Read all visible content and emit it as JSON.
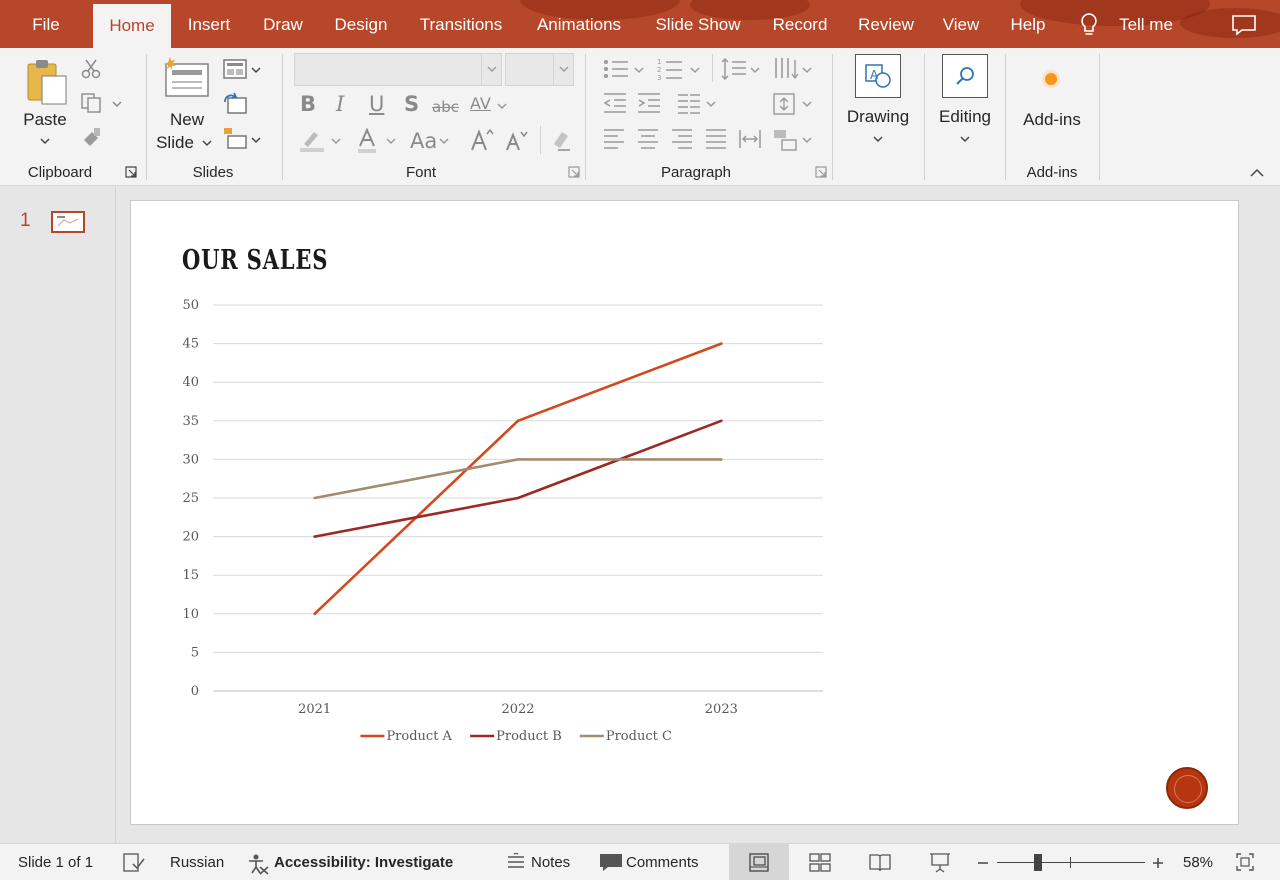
{
  "ribbon_tabs": [
    "File",
    "Home",
    "Insert",
    "Draw",
    "Design",
    "Transitions",
    "Animations",
    "Slide Show",
    "Record",
    "Review",
    "View",
    "Help"
  ],
  "tell_me": "Tell me",
  "active_tab": "Home",
  "clipboard": {
    "paste_label": "Paste",
    "group_label": "Clipboard"
  },
  "slides_group": {
    "new_label": "New",
    "slide_label": "Slide",
    "group_label": "Slides"
  },
  "font_group": {
    "font_name": "",
    "font_size": "",
    "bold": "B",
    "italic": "I",
    "underline": "U",
    "shadow": "S",
    "strike": "abc",
    "spacing": "AV",
    "case": "Aa",
    "group_label": "Font"
  },
  "paragraph_group": {
    "group_label": "Paragraph"
  },
  "drawing": {
    "label": "Drawing"
  },
  "editing": {
    "label": "Editing"
  },
  "addins": {
    "button_label": "Add-ins",
    "group_label": "Add-ins"
  },
  "thumbnail": {
    "number": "1"
  },
  "slide": {
    "title": "OUR SALES"
  },
  "chart_data": {
    "type": "line",
    "title": "",
    "xlabel": "",
    "ylabel": "",
    "categories": [
      "2021",
      "2022",
      "2023"
    ],
    "ylim": [
      0,
      50
    ],
    "yticks": [
      0,
      5,
      10,
      15,
      20,
      25,
      30,
      35,
      40,
      45,
      50
    ],
    "grid": true,
    "legend": "bottom",
    "series": [
      {
        "name": "Product A",
        "values": [
          10,
          35,
          45
        ],
        "color": "#d04a1e"
      },
      {
        "name": "Product B",
        "values": [
          20,
          25,
          35
        ],
        "color": "#9b2a22"
      },
      {
        "name": "Product C",
        "values": [
          25,
          30,
          30
        ],
        "color": "#a38b6c"
      }
    ]
  },
  "status": {
    "slide_info": "Slide 1 of 1",
    "language": "Russian",
    "accessibility": "Accessibility: Investigate",
    "notes": "Notes",
    "comments": "Comments",
    "zoom": "58%"
  },
  "colors": {
    "accent": "#b7472a",
    "ribbon_bg": "#f3f3f3",
    "workspace_bg": "#e6e6e6"
  }
}
